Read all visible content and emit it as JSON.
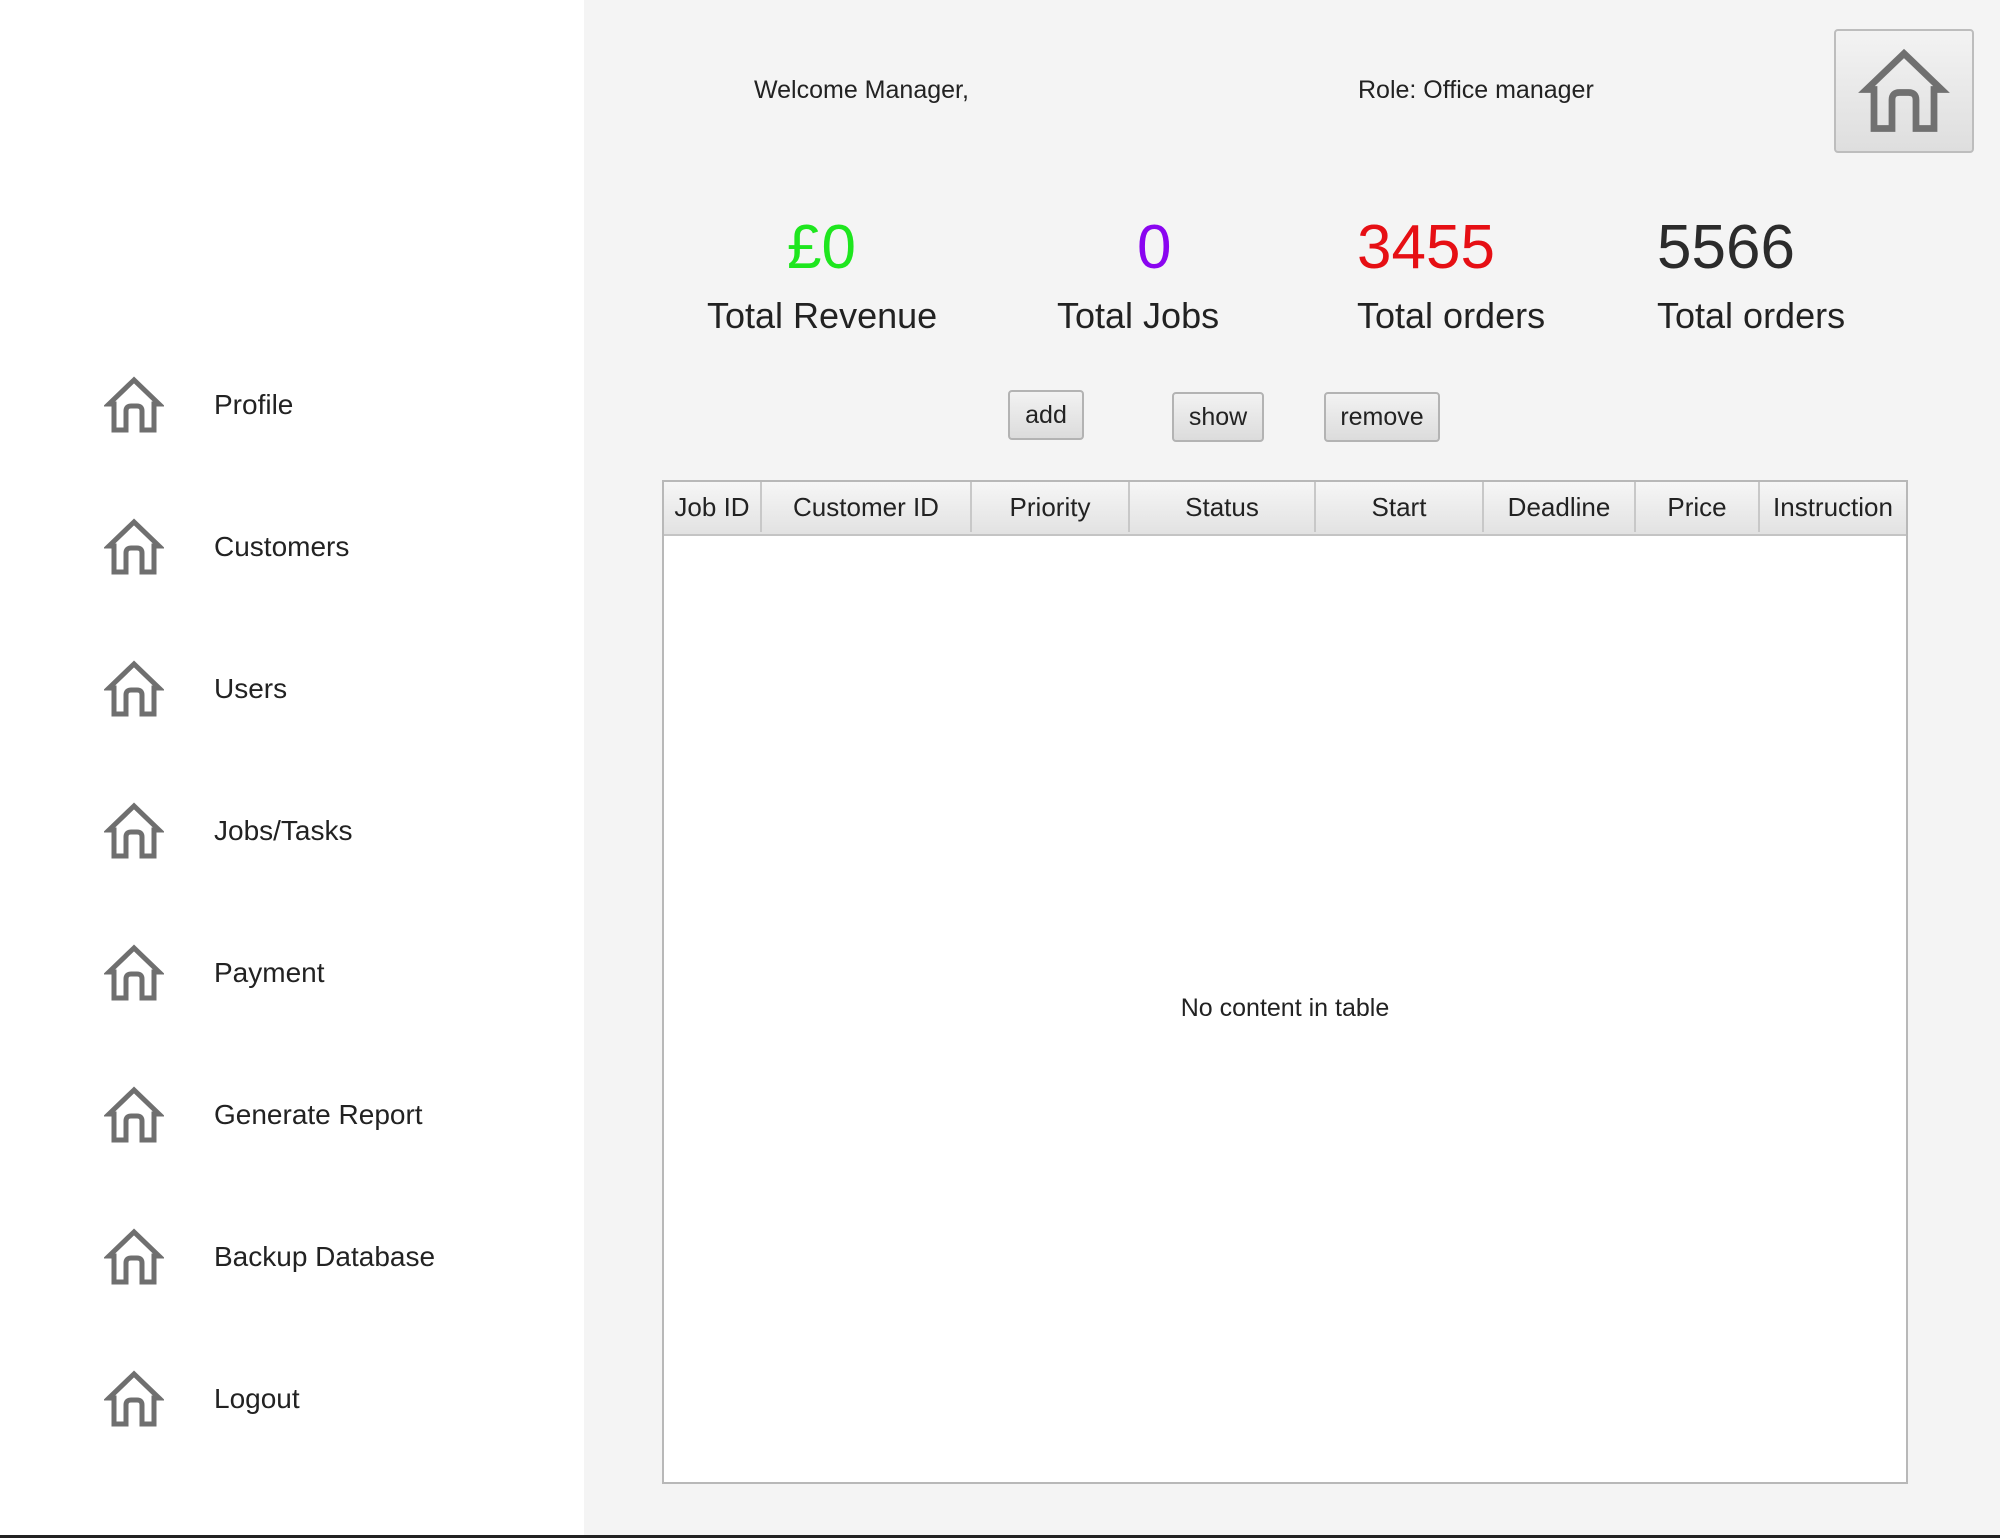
{
  "header": {
    "welcome": "Welcome Manager,",
    "role": "Role: Office manager",
    "home_icon": "home-icon"
  },
  "sidebar": {
    "items": [
      {
        "label": "Profile",
        "icon": "home-icon"
      },
      {
        "label": "Customers",
        "icon": "home-icon"
      },
      {
        "label": "Users",
        "icon": "home-icon"
      },
      {
        "label": "Jobs/Tasks",
        "icon": "home-icon"
      },
      {
        "label": "Payment",
        "icon": "home-icon"
      },
      {
        "label": "Generate Report",
        "icon": "home-icon"
      },
      {
        "label": "Backup Database",
        "icon": "home-icon"
      },
      {
        "label": "Logout",
        "icon": "home-icon"
      }
    ]
  },
  "stats": [
    {
      "value": "£0",
      "label": "Total Revenue",
      "color": "#1ee61e"
    },
    {
      "value": "0",
      "label": "Total Jobs",
      "color": "#8a05f0"
    },
    {
      "value": "3455",
      "label": "Total orders",
      "color": "#e60f14"
    },
    {
      "value": "5566",
      "label": "Total orders",
      "color": "#2b2b2b"
    }
  ],
  "actions": {
    "add": "add",
    "show": "show",
    "remove": "remove"
  },
  "table": {
    "columns": [
      "Job ID",
      "Customer ID",
      "Priority",
      "Status",
      "Start",
      "Deadline",
      "Price",
      "Instruction"
    ],
    "rows": [],
    "empty_text": "No content in table"
  }
}
